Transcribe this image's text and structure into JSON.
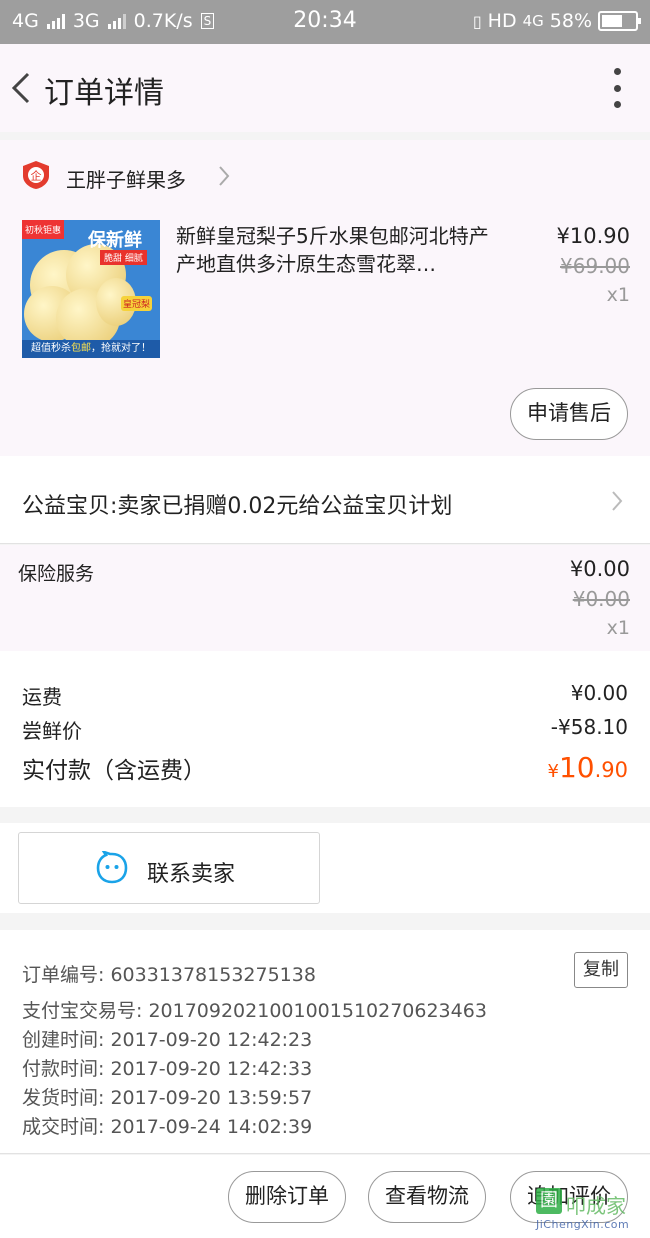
{
  "status_bar": {
    "net1": "4G",
    "net2": "3G",
    "speed": "0.7K/s",
    "time": "20:34",
    "hd": "HD",
    "net3": "4G",
    "battery": "58%",
    "icons": [
      "signal-icon",
      "signal-icon",
      "sim-icon",
      "vibrate-icon",
      "battery-icon"
    ]
  },
  "header": {
    "title": "订单详情",
    "back_icon": "chevron-left-icon",
    "more_icon": "more-vertical-icon"
  },
  "shop": {
    "name": "王胖子鲜果多",
    "logo": "enterprise-shield-icon",
    "logo_text": "企"
  },
  "product": {
    "name": "新鲜皇冠梨子5斤水果包邮河北特产产地直供多汁原生态雪花翠…",
    "price": "¥10.90",
    "original_price": "¥69.00",
    "quantity": "x1",
    "thumbnail": {
      "badge": "初秋钜惠",
      "title": "保新鲜",
      "tag": "脆甜 细腻",
      "crown": "皇冠梨",
      "bottom_text_a": "超值秒杀",
      "bottom_text_b": "包邮",
      "bottom_text_c": "，抢就对了！"
    },
    "aftersale_button": "申请售后"
  },
  "charity": {
    "text": "公益宝贝:卖家已捐赠0.02元给公益宝贝计划"
  },
  "insurance": {
    "label": "保险服务",
    "price": "¥0.00",
    "original_price": "¥0.00",
    "quantity": "x1"
  },
  "summary": {
    "shipping_label": "运费",
    "shipping_value": "¥0.00",
    "discount_label": "尝鲜价",
    "discount_value": "-¥58.10",
    "total_label": "实付款（含运费）",
    "total_currency": "¥",
    "total_int": "10",
    "total_dec": ".90",
    "accent_color": "#ff5000"
  },
  "contact": {
    "label": "联系卖家",
    "icon": "chat-bubble-icon",
    "icon_color": "#1aa3e8"
  },
  "order_info": {
    "order_no": "订单编号: 60331378153275138",
    "copy_button": "复制",
    "alipay_no": "支付宝交易号: 2017092021001001510270623463",
    "created": "创建时间: 2017-09-20 12:42:23",
    "paid": "付款时间: 2017-09-20 12:42:33",
    "shipped": "发货时间: 2017-09-20 13:59:57",
    "completed": "成交时间: 2017-09-24 14:02:39"
  },
  "footer": {
    "delete_button": "删除订单",
    "logistics_button": "查看物流",
    "review_button": "追加评价"
  },
  "watermark": {
    "box": "園",
    "text": "叩成家",
    "url": "JiChengXin.com"
  }
}
